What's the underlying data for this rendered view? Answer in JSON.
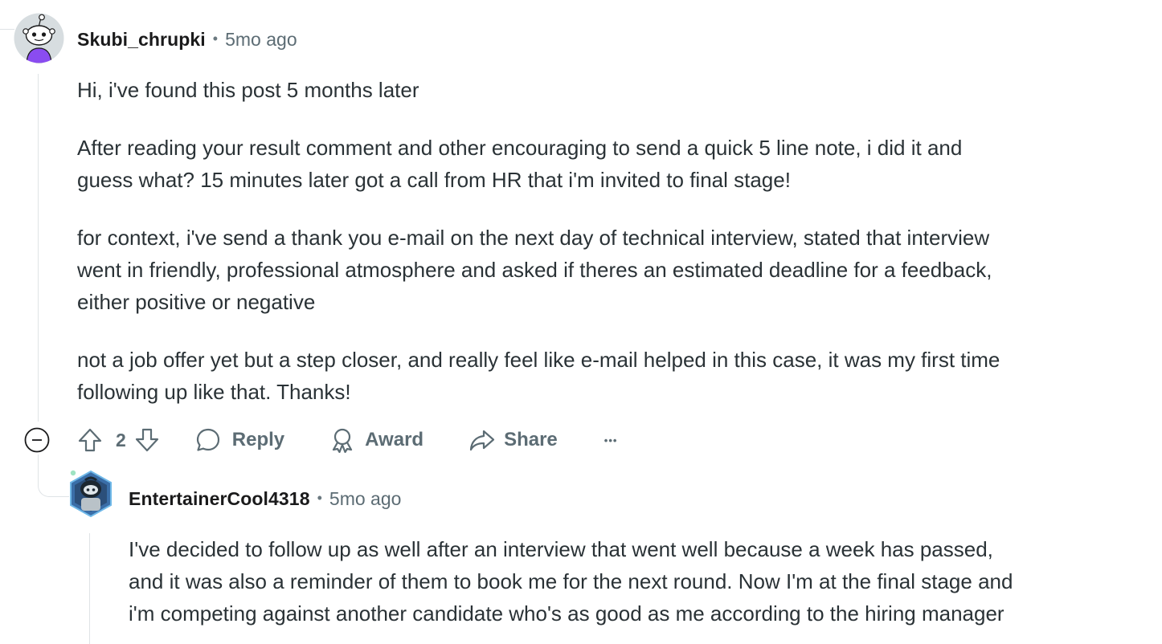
{
  "comment": {
    "author": "Skubi_chrupki",
    "separator": "•",
    "timestamp": "5mo ago",
    "paragraphs": [
      [
        "Hi, i've found this post 5 months later"
      ],
      [
        "After reading your result comment and other encouraging to send a quick 5 line note, i did it and",
        "guess what? 15 minutes later got a call from HR that i'm invited to final stage!"
      ],
      [
        "for context, i've send a thank you e-mail on the next day of technical interview, stated that interview",
        "went in friendly, professional atmosphere and asked if theres an estimated deadline for a feedback,",
        "either positive or negative"
      ],
      [
        "not a job offer yet but a step closer, and really feel like e-mail helped in this case, it was my first time",
        "following up like that. Thanks!"
      ]
    ],
    "actions": {
      "vote_count": "2",
      "reply_label": "Reply",
      "award_label": "Award",
      "share_label": "Share",
      "more_label": "•••"
    },
    "icons": {
      "collapse": "minus-circle-icon",
      "upvote": "arrow-up-outline-icon",
      "downvote": "arrow-down-outline-icon",
      "reply": "speech-bubble-icon",
      "award": "award-ribbon-icon",
      "share": "share-arrow-icon"
    }
  },
  "reply": {
    "author": "EntertainerCool4318",
    "separator": "•",
    "timestamp": "5mo ago",
    "lines": [
      "I've decided to follow up as well after an interview that went well because a week has passed,",
      "and it was also a reminder of them to book me for the next round. Now I'm at the final stage and",
      "i'm competing against another candidate who's as good as me according to the hiring manager"
    ]
  },
  "colors": {
    "text": "#2a3236",
    "muted": "#5c6c74",
    "thread_line": "#dfe3e6",
    "avatar1_bg": "#d7dde0",
    "avatar1_shirt": "#8a4cf0",
    "avatar2_frame": "#3a6ea8"
  }
}
